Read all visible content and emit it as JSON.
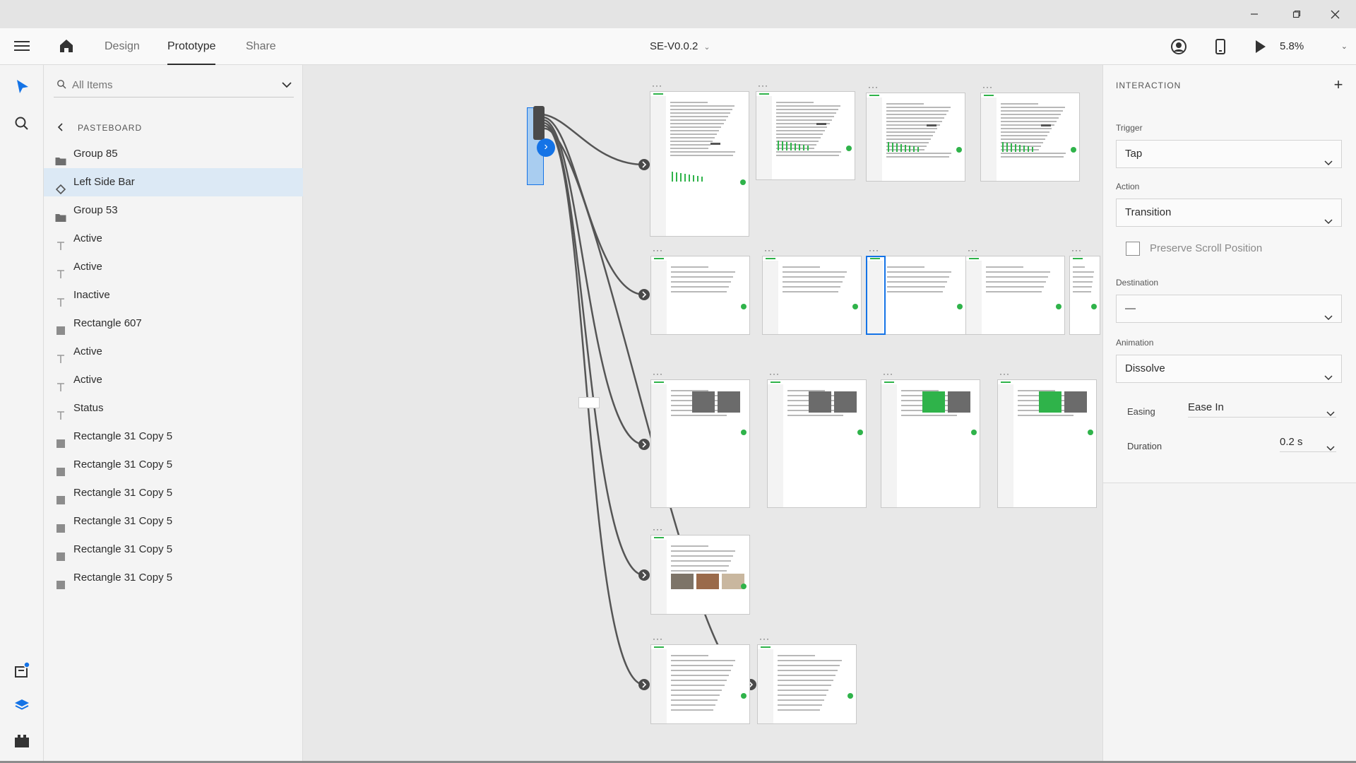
{
  "window": {
    "controls": [
      "minimize-icon",
      "restore-icon",
      "close-icon"
    ]
  },
  "header": {
    "menu_icon": "hamburger-icon",
    "home_icon": "home-icon",
    "tabs": [
      {
        "label": "Design",
        "active": false
      },
      {
        "label": "Prototype",
        "active": true
      },
      {
        "label": "Share",
        "active": false
      }
    ],
    "document_title": "SE-V0.0.2",
    "right_icons": [
      "user-presence-icon",
      "device-preview-icon",
      "play-icon"
    ],
    "zoom": "5.8%"
  },
  "rail": {
    "top_icons": [
      "select-tool-icon",
      "search-tool-icon"
    ],
    "bottom_icons": [
      "assets-icon",
      "layers-icon",
      "plugins-icon"
    ],
    "notification_color": "#1473e6"
  },
  "layers": {
    "search_placeholder": "All Items",
    "section": "PASTEBOARD",
    "items": [
      {
        "label": "Group 85",
        "icon": "folder-icon",
        "selected": false
      },
      {
        "label": "Left Side Bar",
        "icon": "component-icon",
        "selected": true
      },
      {
        "label": "Group 53",
        "icon": "folder-icon",
        "selected": false
      },
      {
        "label": "Active",
        "icon": "text-icon",
        "selected": false
      },
      {
        "label": "Active",
        "icon": "text-icon",
        "selected": false
      },
      {
        "label": "Inactive",
        "icon": "text-icon",
        "selected": false
      },
      {
        "label": "Rectangle 607",
        "icon": "rectangle-icon",
        "selected": false
      },
      {
        "label": "Active",
        "icon": "text-icon",
        "selected": false
      },
      {
        "label": "Active",
        "icon": "text-icon",
        "selected": false
      },
      {
        "label": "Status",
        "icon": "text-icon",
        "selected": false
      },
      {
        "label": "Rectangle 31 Copy 5",
        "icon": "rectangle-icon",
        "selected": false
      },
      {
        "label": "Rectangle 31 Copy 5",
        "icon": "rectangle-icon",
        "selected": false
      },
      {
        "label": "Rectangle 31 Copy 5",
        "icon": "rectangle-icon",
        "selected": false
      },
      {
        "label": "Rectangle 31 Copy 5",
        "icon": "rectangle-icon",
        "selected": false
      },
      {
        "label": "Rectangle 31 Copy 5",
        "icon": "rectangle-icon",
        "selected": false
      },
      {
        "label": "Rectangle 31 Copy 5",
        "icon": "rectangle-icon",
        "selected": false
      }
    ]
  },
  "canvas": {
    "accent_green": "#2fb34a",
    "wire_color": "#555555",
    "selection_color": "#1473e6"
  },
  "interaction": {
    "title": "INTERACTION",
    "trigger_label": "Trigger",
    "trigger_value": "Tap",
    "action_label": "Action",
    "action_value": "Transition",
    "preserve_scroll_label": "Preserve Scroll Position",
    "preserve_scroll_checked": false,
    "destination_label": "Destination",
    "destination_value": "—",
    "animation_label": "Animation",
    "animation_value": "Dissolve",
    "easing_label": "Easing",
    "easing_value": "Ease In",
    "duration_label": "Duration",
    "duration_value": "0.2 s"
  }
}
